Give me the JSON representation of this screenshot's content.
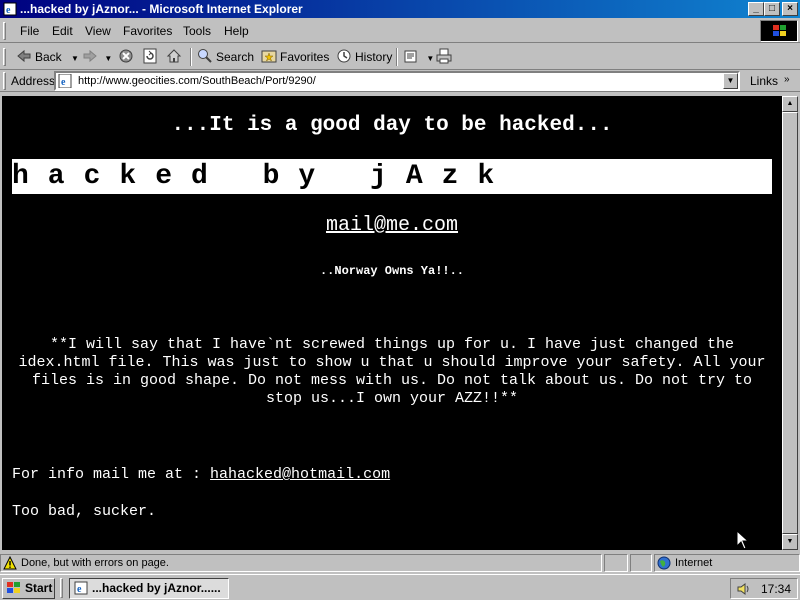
{
  "window": {
    "title": "...hacked by jAznor... - Microsoft Internet Explorer",
    "buttons": {
      "minimize": "_",
      "maximize": "□",
      "close": "×"
    }
  },
  "menu": [
    "File",
    "Edit",
    "View",
    "Favorites",
    "Tools",
    "Help"
  ],
  "toolbar": {
    "back_label": "Back",
    "search_label": "Search",
    "favorites_label": "Favorites",
    "history_label": "History"
  },
  "address": {
    "label": "Address",
    "url": "http://www.geocities.com/SouthBeach/Port/9290/",
    "links_label": "Links"
  },
  "page": {
    "tagline": "...It is a good day to be hacked...",
    "banner": "hacked by jAzk",
    "mail_link": "mail@me.com",
    "norway": "..Norway Owns Ya!!..",
    "message": "**I will say that I have`nt screwed things up for u. I have just changed the idex.html file. This was just to show u that u should improve your safety. All your files is in good shape. Do not mess with us. Do not talk about us. Do not try to stop us...I own your AZZ!!**",
    "info_prefix": "For info mail me at : ",
    "info_email": "hahacked@hotmail.com",
    "sign_off": "Too bad, sucker."
  },
  "status": {
    "text": "Done, but with errors on page.",
    "zone": "Internet"
  },
  "taskbar": {
    "start_label": "Start",
    "task_label": "...hacked by jAznor......",
    "clock": "17:34"
  },
  "colors": {
    "title_start": "#000080",
    "title_end": "#1084d0",
    "chrome": "#c0c0c0",
    "page_bg": "#000000",
    "page_text": "#ffffff"
  }
}
